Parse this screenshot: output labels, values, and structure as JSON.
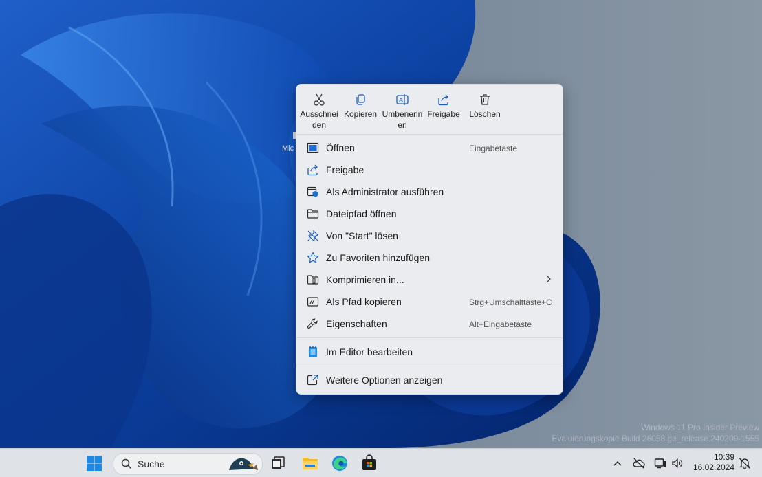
{
  "desktop": {
    "icon_label": "Mic",
    "watermark_line1": "Windows 11 Pro Insider Preview",
    "watermark_line2": "Evaluierungskopie Build 26058.ge_release.240209-1555"
  },
  "context_menu": {
    "quick_actions": [
      {
        "label": "Ausschnei\nden",
        "icon": "scissors-icon"
      },
      {
        "label": "Kopieren",
        "icon": "copy-icon"
      },
      {
        "label": "Umbenenn\nen",
        "icon": "rename-icon"
      },
      {
        "label": "Freigabe",
        "icon": "share-icon"
      },
      {
        "label": "Löschen",
        "icon": "trash-icon"
      }
    ],
    "items": [
      {
        "label": "Öffnen",
        "shortcut": "Eingabetaste",
        "icon": "open-window-icon"
      },
      {
        "label": "Freigabe",
        "shortcut": "",
        "icon": "share-icon"
      },
      {
        "label": "Als Administrator ausführen",
        "shortcut": "",
        "icon": "admin-shield-icon"
      },
      {
        "label": "Dateipfad öffnen",
        "shortcut": "",
        "icon": "folder-icon"
      },
      {
        "label": "Von \"Start\" lösen",
        "shortcut": "",
        "icon": "unpin-icon"
      },
      {
        "label": "Zu Favoriten hinzufügen",
        "shortcut": "",
        "icon": "star-icon"
      },
      {
        "label": "Komprimieren in...",
        "shortcut": "",
        "icon": "zip-folder-icon",
        "has_submenu": true
      },
      {
        "label": "Als Pfad kopieren",
        "shortcut": "Strg+Umschalttaste+C",
        "icon": "path-icon"
      },
      {
        "label": "Eigenschaften",
        "shortcut": "Alt+Eingabetaste",
        "icon": "wrench-icon"
      },
      {
        "label": "Im Editor bearbeiten",
        "shortcut": "",
        "icon": "notepad-icon"
      },
      {
        "label": "Weitere Optionen anzeigen",
        "shortcut": "",
        "icon": "more-options-icon"
      }
    ]
  },
  "taskbar": {
    "search_placeholder": "Suche",
    "time": "10:39",
    "date": "16.02.2024"
  },
  "colors": {
    "accent": "#0067c0",
    "menu_bg": "#eaecef",
    "taskbar_bg": "#dfe3e7"
  }
}
